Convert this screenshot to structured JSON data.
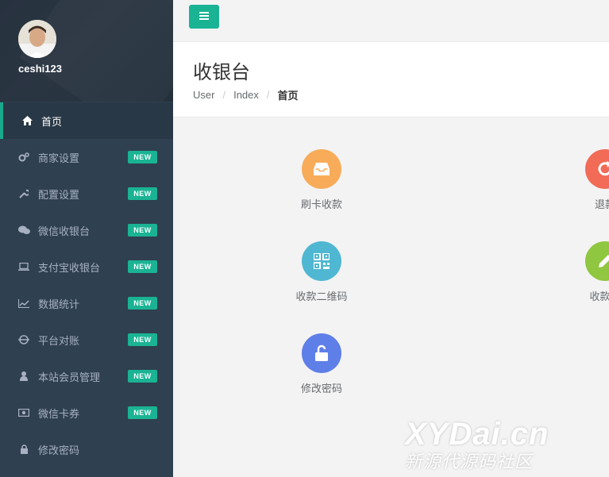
{
  "user": {
    "name": "ceshi123"
  },
  "sidebar": {
    "items": [
      {
        "label": "首页",
        "icon": "home-icon",
        "active": true,
        "badge": ""
      },
      {
        "label": "商家设置",
        "icon": "gears-icon",
        "badge": "NEW"
      },
      {
        "label": "配置设置",
        "icon": "wrench-icon",
        "badge": "NEW"
      },
      {
        "label": "微信收银台",
        "icon": "wechat-icon",
        "badge": "NEW"
      },
      {
        "label": "支付宝收银台",
        "icon": "laptop-icon",
        "badge": "NEW"
      },
      {
        "label": "数据统计",
        "icon": "line-chart-icon",
        "badge": "NEW"
      },
      {
        "label": "平台对账",
        "icon": "reconcile-icon",
        "badge": "NEW"
      },
      {
        "label": "本站会员管理",
        "icon": "user-icon",
        "badge": "NEW"
      },
      {
        "label": "微信卡券",
        "icon": "money-icon",
        "badge": "NEW"
      },
      {
        "label": "修改密码",
        "icon": "lock-icon",
        "badge": ""
      }
    ]
  },
  "page": {
    "title": "收银台",
    "breadcrumb": [
      "User",
      "Index",
      "首页"
    ]
  },
  "tiles": [
    {
      "label": "刷卡收款",
      "icon": "inbox-icon",
      "color": "#f8ac59"
    },
    {
      "label": "退款",
      "icon": "refresh-icon",
      "color": "#ed5565"
    },
    {
      "label": "收款二维码",
      "icon": "qrcode-icon",
      "color": "#23c6c8"
    },
    {
      "label": "收款记",
      "icon": "pencil-icon",
      "color": "#8fc740"
    },
    {
      "label": "修改密码",
      "icon": "unlock-icon",
      "color": "#5f7fe8"
    }
  ],
  "watermark": {
    "line1": "XYDai.cn",
    "line2": "新源代源码社区"
  },
  "colors": {
    "sidebar": "#2f4050",
    "accent": "#1ab394"
  }
}
